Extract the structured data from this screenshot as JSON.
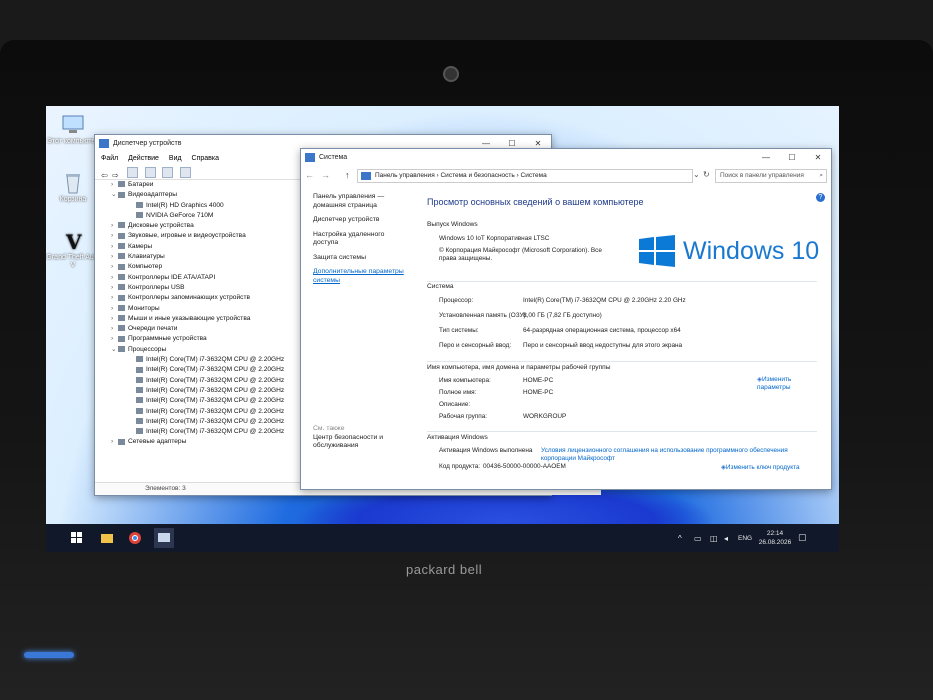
{
  "desktop": {
    "icons": [
      {
        "label": "Этот компьютер",
        "icon": "computer-icon"
      },
      {
        "label": "Корзина",
        "icon": "recycle-bin-icon"
      },
      {
        "label": "Grand Theft Auto V",
        "icon": "gta-icon"
      }
    ]
  },
  "device_manager": {
    "title": "Диспетчер устройств",
    "menu": [
      "Файл",
      "Действие",
      "Вид",
      "Справка"
    ],
    "tree": [
      {
        "text": "Батареи",
        "indent": 1,
        "tw": ">"
      },
      {
        "text": "Видеоадаптеры",
        "indent": 1,
        "tw": "v"
      },
      {
        "text": "Intel(R) HD Graphics 4000",
        "indent": 2,
        "tw": ""
      },
      {
        "text": "NVIDIA GeForce 710M",
        "indent": 2,
        "tw": ""
      },
      {
        "text": "Дисковые устройства",
        "indent": 1,
        "tw": ">"
      },
      {
        "text": "Звуковые, игровые и видеоустройства",
        "indent": 1,
        "tw": ">"
      },
      {
        "text": "Камеры",
        "indent": 1,
        "tw": ">"
      },
      {
        "text": "Клавиатуры",
        "indent": 1,
        "tw": ">"
      },
      {
        "text": "Компьютер",
        "indent": 1,
        "tw": ">"
      },
      {
        "text": "Контроллеры IDE ATA/ATAPI",
        "indent": 1,
        "tw": ">"
      },
      {
        "text": "Контроллеры USB",
        "indent": 1,
        "tw": ">"
      },
      {
        "text": "Контроллеры запоминающих устройств",
        "indent": 1,
        "tw": ">"
      },
      {
        "text": "Мониторы",
        "indent": 1,
        "tw": ">"
      },
      {
        "text": "Мыши и иные указывающие устройства",
        "indent": 1,
        "tw": ">"
      },
      {
        "text": "Очереди печати",
        "indent": 1,
        "tw": ">"
      },
      {
        "text": "Программные устройства",
        "indent": 1,
        "tw": ">"
      },
      {
        "text": "Процессоры",
        "indent": 1,
        "tw": "v"
      },
      {
        "text": "Intel(R) Core(TM) i7-3632QM CPU @ 2.20GHz",
        "indent": 2,
        "tw": ""
      },
      {
        "text": "Intel(R) Core(TM) i7-3632QM CPU @ 2.20GHz",
        "indent": 2,
        "tw": ""
      },
      {
        "text": "Intel(R) Core(TM) i7-3632QM CPU @ 2.20GHz",
        "indent": 2,
        "tw": ""
      },
      {
        "text": "Intel(R) Core(TM) i7-3632QM CPU @ 2.20GHz",
        "indent": 2,
        "tw": ""
      },
      {
        "text": "Intel(R) Core(TM) i7-3632QM CPU @ 2.20GHz",
        "indent": 2,
        "tw": ""
      },
      {
        "text": "Intel(R) Core(TM) i7-3632QM CPU @ 2.20GHz",
        "indent": 2,
        "tw": ""
      },
      {
        "text": "Intel(R) Core(TM) i7-3632QM CPU @ 2.20GHz",
        "indent": 2,
        "tw": ""
      },
      {
        "text": "Intel(R) Core(TM) i7-3632QM CPU @ 2.20GHz",
        "indent": 2,
        "tw": ""
      },
      {
        "text": "Сетевые адаптеры",
        "indent": 1,
        "tw": ">"
      }
    ],
    "status": "Элементов: 3"
  },
  "system": {
    "title": "Система",
    "breadcrumb": "Панель управления  ›  Система и безопасность  ›  Система",
    "search_placeholder": "Поиск в панели управления",
    "left_nav": {
      "home": "Панель управления — домашняя страница",
      "links": [
        "Диспетчер устройств",
        "Настройка удаленного доступа",
        "Защита системы",
        "Дополнительные параметры системы"
      ],
      "see_also": "См. также",
      "security": "Центр безопасности и обслуживания"
    },
    "heading": "Просмотр основных сведений о вашем компьютере",
    "edition_section": "Выпуск Windows",
    "edition": "Windows 10 IoT Корпоративная LTSC",
    "copyright": "© Корпорация Майкрософт (Microsoft Corporation). Все права защищены.",
    "logo_text": "Windows 10",
    "system_section": "Система",
    "system_rows": [
      {
        "label": "Процессор:",
        "value": "Intel(R) Core(TM) i7-3632QM CPU @ 2.20GHz   2.20 GHz"
      },
      {
        "label": "Установленная память (ОЗУ):",
        "value": "8,00 ГБ (7,82 ГБ доступно)"
      },
      {
        "label": "Тип системы:",
        "value": "64-разрядная операционная система, процессор x64"
      },
      {
        "label": "Перо и сенсорный ввод:",
        "value": "Перо и сенсорный ввод недоступны для этого экрана"
      }
    ],
    "name_section": "Имя компьютера, имя домена и параметры рабочей группы",
    "name_rows": [
      {
        "label": "Имя компьютера:",
        "value": "HOME-PC"
      },
      {
        "label": "Полное имя:",
        "value": "HOME-PC"
      },
      {
        "label": "Описание:",
        "value": ""
      },
      {
        "label": "Рабочая группа:",
        "value": "WORKGROUP"
      }
    ],
    "change_params": "Изменить параметры",
    "activation_section": "Активация Windows",
    "activation_label": "Активация Windows выполнена",
    "license_link": "Условия лицензионного соглашения на использование программного обеспечения корпорации Майкрософт",
    "product_label": "Код продукта:",
    "product_code": "00436-50000-00000-AAOEM",
    "change_key": "Изменить ключ продукта"
  },
  "taskbar": {
    "lang": "ENG",
    "time": "22:14",
    "date": "26.08.2026"
  },
  "laptop_brand": "packard bell",
  "colors": {
    "accent": "#0067c0",
    "link": "#0066cc",
    "taskbar": "#10182a"
  }
}
